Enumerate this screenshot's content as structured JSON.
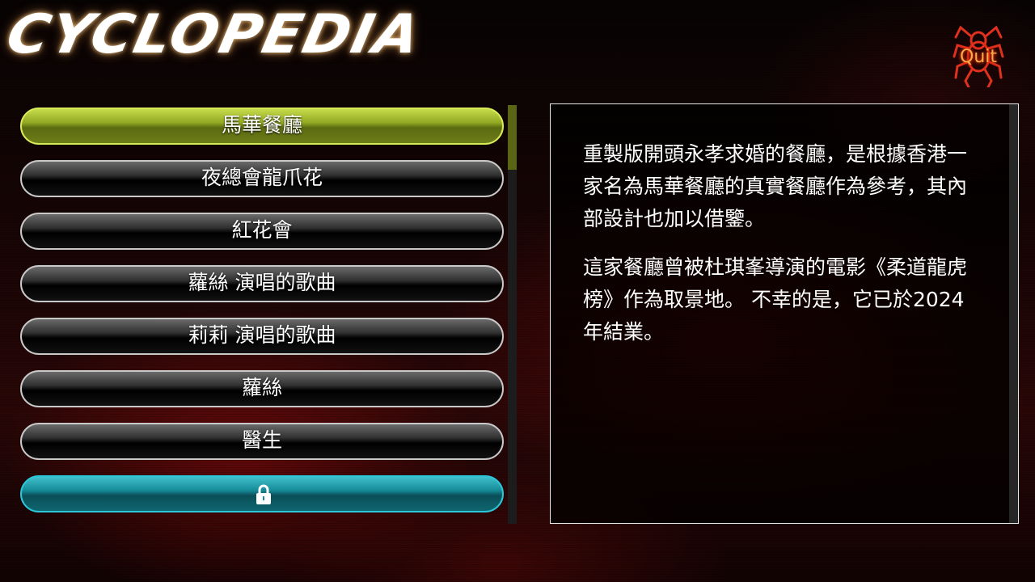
{
  "app": {
    "title": "CYCLOPEDIA"
  },
  "quit": {
    "label": "Quit"
  },
  "menu": {
    "items": [
      {
        "label": "馬華餐廳"
      },
      {
        "label": "夜總會龍爪花"
      },
      {
        "label": "紅花會"
      },
      {
        "label": "蘿絲 演唱的歌曲"
      },
      {
        "label": "莉莉 演唱的歌曲"
      },
      {
        "label": "蘿絲"
      },
      {
        "label": "醫生"
      },
      {
        "label": ""
      }
    ],
    "selected_index": 0,
    "locked_icon": "lock-icon"
  },
  "detail": {
    "paragraphs": [
      "重製版開頭永孝求婚的餐廳，是根據香港一家名為馬華餐廳的真實餐廳作為參考，其內部設計也加以借鑒。",
      "這家餐廳曾被杜琪峯導演的電影《柔道龍虎榜》作為取景地。 不幸的是，它已於2024年結業。"
    ]
  },
  "colors": {
    "selected": "#93a823",
    "locked": "#168a97",
    "quit_glow": "#ffa84a"
  }
}
